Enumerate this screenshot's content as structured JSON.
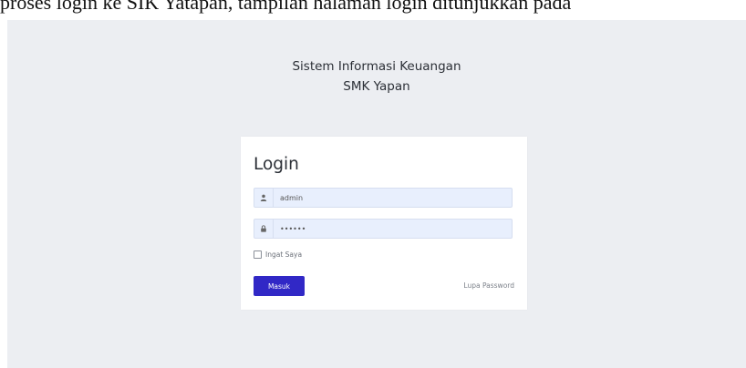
{
  "document_text": "proses login ke SIK Yatapan, tampilan halaman login ditunjukkan pada",
  "app": {
    "title_line1": "Sistem Informasi Keuangan",
    "title_line2": "SMK Yapan"
  },
  "login_card": {
    "heading": "Login",
    "username_value": "admin",
    "password_value": "••••••",
    "remember_label": "Ingat Saya",
    "remember_checked": false,
    "submit_label": "Masuk",
    "forgot_label": "Lupa Password"
  },
  "icons": {
    "username": "user-icon",
    "password": "lock-icon"
  },
  "colors": {
    "background": "#eceef2",
    "card": "#ffffff",
    "input_fill": "#e8effd",
    "primary_button": "#3128c6"
  }
}
